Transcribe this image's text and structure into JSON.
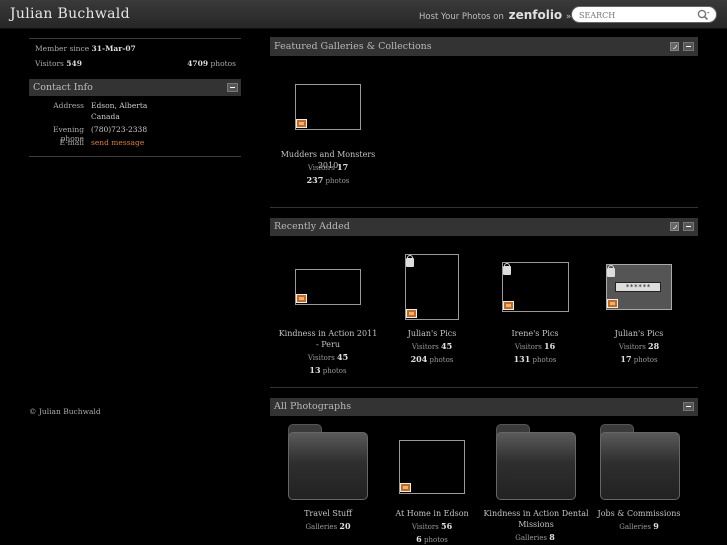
{
  "header": {
    "title": "Julian Buchwald",
    "host_label": "Host Your Photos on",
    "host_brand": "zenfolio",
    "host_arrow": "»",
    "search_placeholder": "SEARCH"
  },
  "profile": {
    "member_since_label": "Member since",
    "member_since": "31-Mar-07",
    "visitors_label": "Visitors",
    "visitors": "549",
    "photos_count": "4709",
    "photos_label": "photos"
  },
  "contact": {
    "title": "Contact Info",
    "address_label": "Address",
    "address_line1": "Edson, Alberta",
    "address_line2": "Canada",
    "phone_label": "Evening phone",
    "phone": "(780)723-2338",
    "email_label": "E-mail",
    "email_link": "send message"
  },
  "footer": {
    "copyright": "© Julian Buchwald"
  },
  "featured": {
    "title": "Featured Galleries & Collections",
    "items": [
      {
        "name": "Mudders and Monsters 2010",
        "visitors_label": "Visitors",
        "visitors": "17",
        "photos": "237",
        "photos_label": "photos"
      }
    ]
  },
  "recent": {
    "title": "Recently Added",
    "password_mask": "******",
    "items": [
      {
        "name": "Kindness in Action 2011 - Peru",
        "visitors_label": "Visitors",
        "visitors": "45",
        "photos": "13",
        "photos_label": "photos"
      },
      {
        "name": "Julian's Pics",
        "visitors_label": "Visitors",
        "visitors": "45",
        "photos": "204",
        "photos_label": "photos"
      },
      {
        "name": "Irene's Pics",
        "visitors_label": "Visitors",
        "visitors": "16",
        "photos": "131",
        "photos_label": "photos"
      },
      {
        "name": "Julian's Pics",
        "visitors_label": "Visitors",
        "visitors": "28",
        "photos": "17",
        "photos_label": "photos"
      }
    ]
  },
  "all": {
    "title": "All Photographs",
    "items": [
      {
        "name": "Travel Stuff",
        "count_label": "Galleries",
        "count": "20"
      },
      {
        "name": "At Home in Edson",
        "visitors_label": "Visitors",
        "visitors": "56",
        "photos": "6",
        "photos_label": "photos"
      },
      {
        "name": "Kindness in Action Dental Missions",
        "count_label": "Galleries",
        "count": "8"
      },
      {
        "name": "Jobs & Commissions",
        "count_label": "Galleries",
        "count": "9"
      }
    ]
  }
}
